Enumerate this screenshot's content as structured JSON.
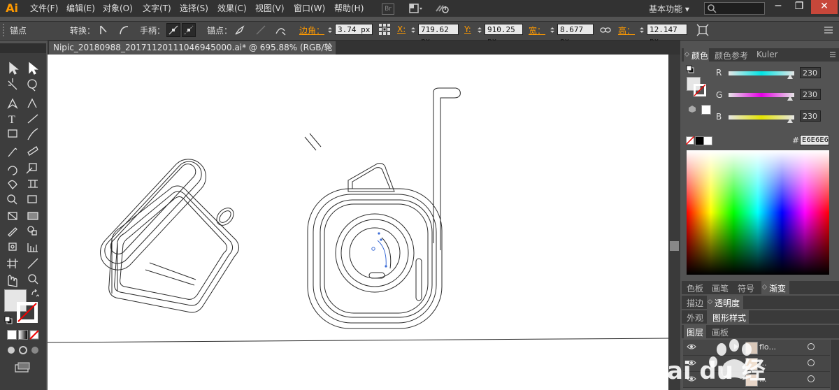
{
  "app": {
    "logo": "Ai"
  },
  "menu": [
    "文件(F)",
    "编辑(E)",
    "对象(O)",
    "文字(T)",
    "选择(S)",
    "效果(C)",
    "视图(V)",
    "窗口(W)",
    "帮助(H)"
  ],
  "bridge_label": "Br",
  "workspace": {
    "label": "基本功能",
    "arrow": "▾"
  },
  "window_buttons": {
    "minimize": "─",
    "restore": "❐",
    "close": "✕"
  },
  "control": {
    "anchor_label": "锚点",
    "convert_label": "转换：",
    "handles_label": "手柄：",
    "anchors_label": "锚点：",
    "corner_label": "边角：",
    "corner_value": "3.74 px",
    "x_label": "X:",
    "x_value": "719.62 px",
    "y_label": "Y:",
    "y_value": "910.25 px",
    "w_label": "宽：",
    "w_value": "8.677 px",
    "h_label": "高：",
    "h_value": "12.147 px"
  },
  "document_tab": {
    "title": "Nipic_20180988_20171120111046945000.ai* @ 695.88% (RGB/轮廓)",
    "close": "×"
  },
  "color_panel": {
    "tabs": [
      "颜色",
      "颜色参考",
      "Kuler"
    ],
    "channels": [
      {
        "name": "R",
        "value": "230",
        "color": "#00e5e5"
      },
      {
        "name": "G",
        "value": "230",
        "color": "#e500e5"
      },
      {
        "name": "B",
        "value": "230",
        "color": "#e5e500"
      }
    ],
    "hex_label": "#",
    "hex_value": "E6E6E6",
    "fill_color": "#e6e6e6"
  },
  "swatch_tabs": [
    "色板",
    "画笔",
    "符号",
    "渐变"
  ],
  "stroke_tabs": [
    "描边",
    "透明度"
  ],
  "appearance_tabs": [
    "外观",
    "图形样式"
  ],
  "layer_tabs": [
    "图层",
    "画板"
  ],
  "layers": [
    {
      "name": "flo..."
    },
    {
      "name": "..."
    },
    {
      "name": "..."
    }
  ],
  "watermark": {
    "text": "ai du 经"
  }
}
